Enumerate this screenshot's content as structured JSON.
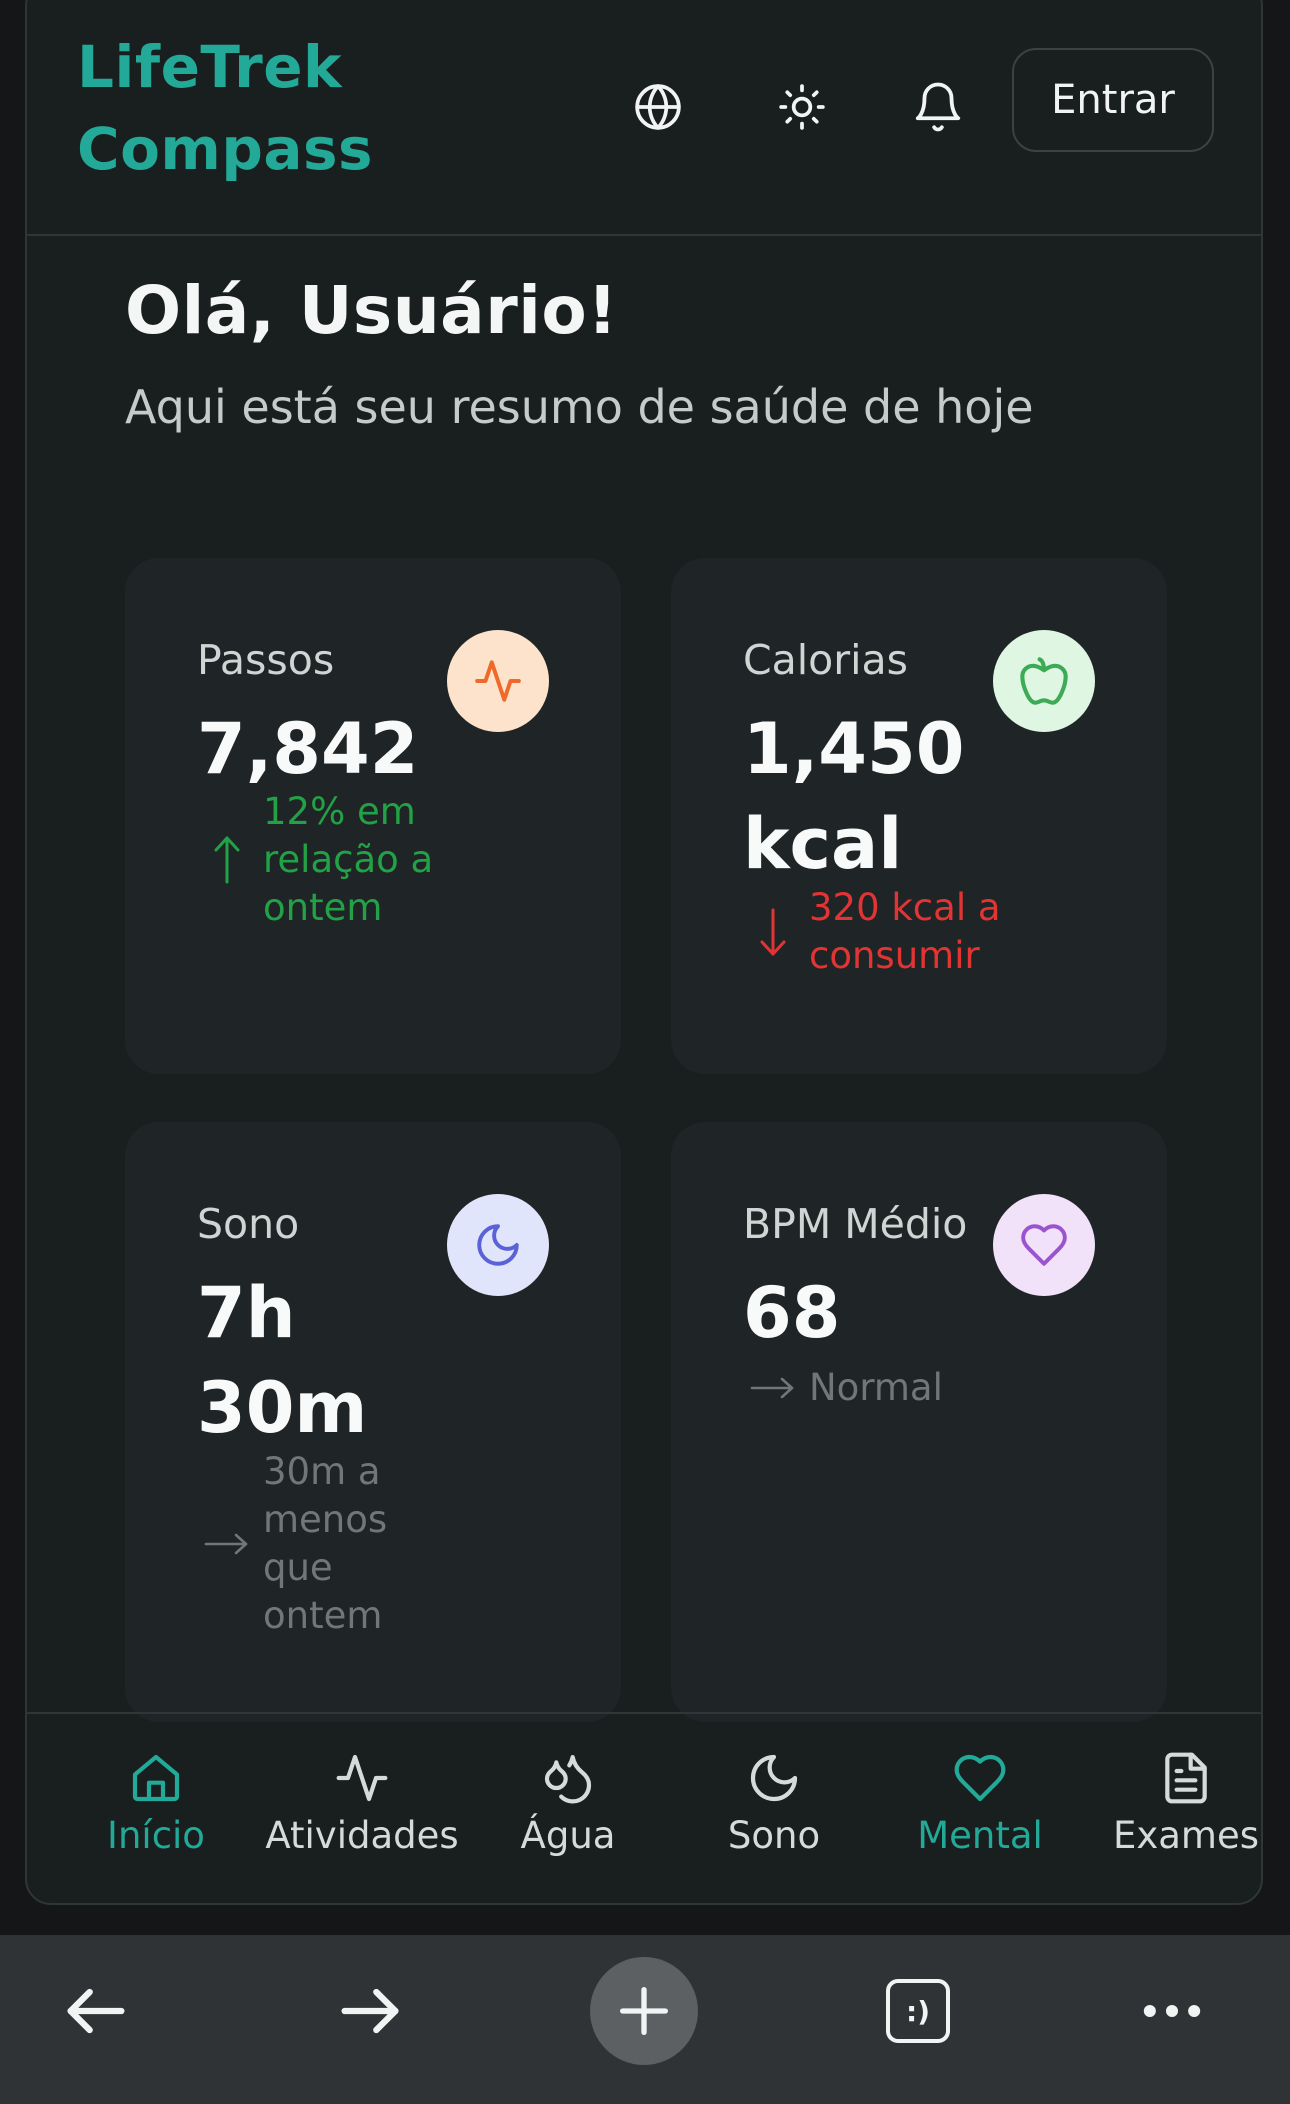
{
  "header": {
    "brand_line1": "LifeTrek",
    "brand_line2": "Compass",
    "login_label": "Entrar"
  },
  "hero": {
    "greeting": "Olá, Usuário!",
    "subtitle": "Aqui está seu resumo de saúde de hoje"
  },
  "cards": [
    {
      "label": "Passos",
      "value_lines": [
        "7,842"
      ],
      "trend_lines": [
        "12% em",
        "relação a",
        "ontem"
      ],
      "trend_direction": "up",
      "trend_color": "#22a146",
      "icon": "activity-icon",
      "icon_bg": "#fde3cb",
      "icon_color": "#ef6a2a"
    },
    {
      "label": "Calorias",
      "value_lines": [
        "1,450",
        "kcal"
      ],
      "trend_lines": [
        "320 kcal a",
        "consumir"
      ],
      "trend_direction": "down",
      "trend_color": "#e33434",
      "icon": "apple-icon",
      "icon_bg": "#dff6e3",
      "icon_color": "#3dab55"
    },
    {
      "label": "Sono",
      "value_lines": [
        "7h",
        "30m"
      ],
      "trend_lines": [
        "30m a",
        "menos",
        "que",
        "ontem"
      ],
      "trend_direction": "neutral",
      "trend_color": "#6f7778",
      "icon": "moon-icon",
      "icon_bg": "#e1e5fb",
      "icon_color": "#5a62d6"
    },
    {
      "label": "BPM Médio",
      "value_lines": [
        "68"
      ],
      "trend_lines": [
        "Normal"
      ],
      "trend_direction": "neutral",
      "trend_color": "#6f7778",
      "icon": "heart-icon",
      "icon_bg": "#f1e1f9",
      "icon_color": "#9b54cf"
    }
  ],
  "nav": {
    "items": [
      {
        "label": "Início",
        "icon": "home-icon",
        "active": true
      },
      {
        "label": "Atividades",
        "icon": "activity-icon",
        "active": false
      },
      {
        "label": "Água",
        "icon": "droplets-icon",
        "active": false
      },
      {
        "label": "Sono",
        "icon": "moon-icon",
        "active": false
      },
      {
        "label": "Mental",
        "icon": "heart-icon",
        "active": true
      },
      {
        "label": "Exames",
        "icon": "file-text-icon",
        "active": false
      }
    ],
    "active_color": "#22a997",
    "inactive_color": "#d6dbda"
  },
  "browser": {
    "items": [
      "back-arrow-icon",
      "forward-arrow-icon",
      "new-tab-plus-icon",
      "tab-switcher-icon",
      "more-menu-icon"
    ],
    "tab_glyph": ":)"
  },
  "colors": {
    "accent": "#22a997",
    "background": "#191e1f",
    "card": "#1f2526"
  }
}
